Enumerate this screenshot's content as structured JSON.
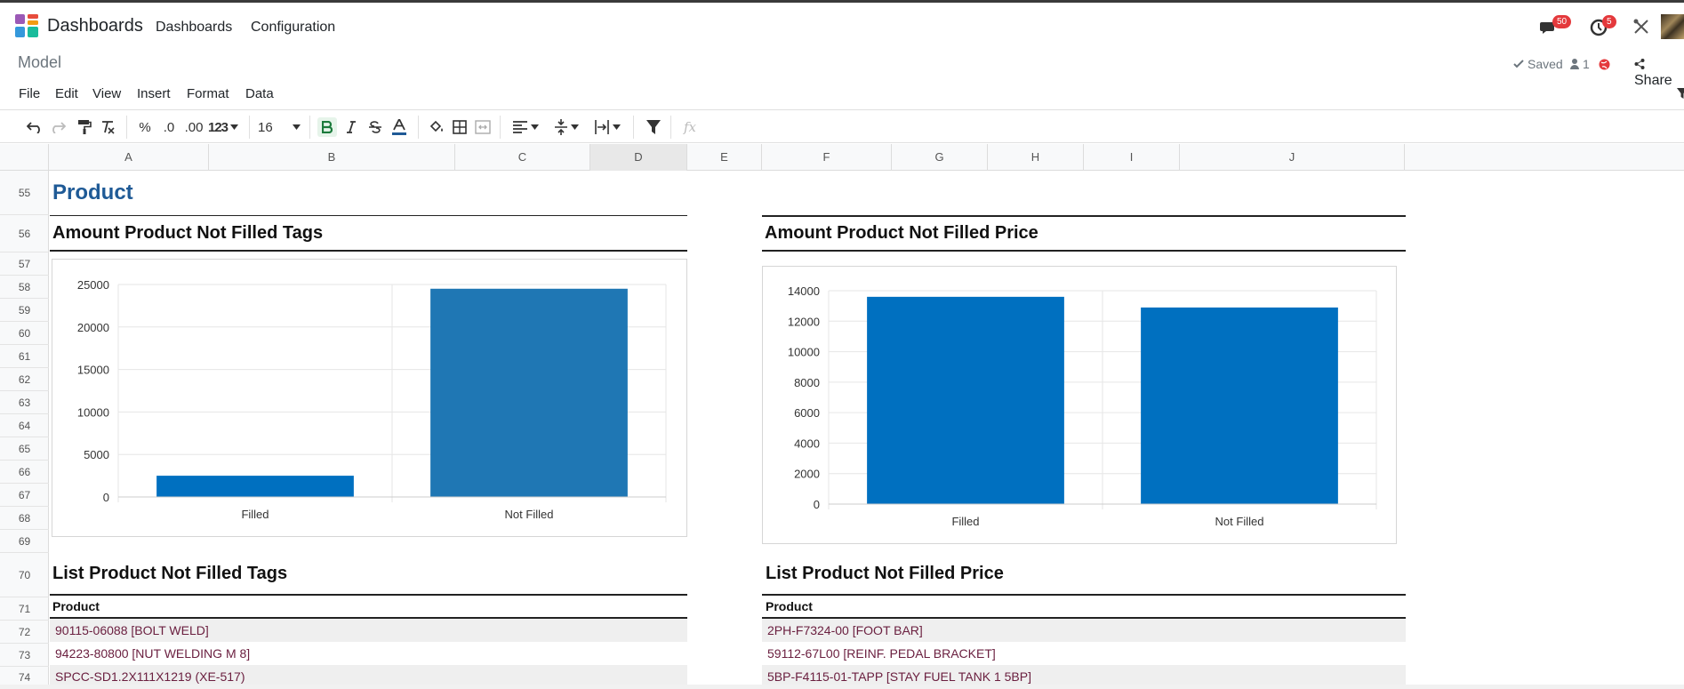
{
  "nav": {
    "app_name": "Dashboards",
    "menus": [
      "Dashboards",
      "Configuration"
    ],
    "messages_count": "50",
    "activities_count": "5"
  },
  "control": {
    "breadcrumb": "Model",
    "saved_label": "Saved",
    "users_count": "1",
    "share_label": "Share"
  },
  "menubar": [
    "File",
    "Edit",
    "View",
    "Insert",
    "Format",
    "Data"
  ],
  "toolbar": {
    "percent": "%",
    "dec_decrease": ".0",
    "dec_increase": ".00",
    "num_format": "123",
    "font_size": "16",
    "fx": "fx"
  },
  "columns": [
    "A",
    "B",
    "C",
    "D",
    "E",
    "F",
    "G",
    "H",
    "I",
    "J"
  ],
  "selected_column": "D",
  "rows": [
    "55",
    "56",
    "57",
    "58",
    "59",
    "60",
    "61",
    "62",
    "63",
    "64",
    "65",
    "66",
    "67",
    "68",
    "69",
    "70",
    "71",
    "72",
    "73",
    "74"
  ],
  "sheet": {
    "main_title": "Product",
    "left_chart_title": "Amount Product Not Filled Tags",
    "right_chart_title": "Amount Product Not Filled Price",
    "left_list_title": "List Product Not Filled Tags",
    "right_list_title": "List Product Not Filled Price",
    "left_list_header": "Product",
    "right_list_header": "Product",
    "left_list": [
      "90115-06088 [BOLT WELD]",
      "94223-80800 [NUT WELDING M 8]",
      "SPCC-SD1.2X111X1219 (XE-517)"
    ],
    "right_list": [
      "2PH-F7324-00 [FOOT BAR]",
      "59112-67L00 [REINF. PEDAL BRACKET]",
      "5BP-F4115-01-TAPP [STAY FUEL TANK 1 5BP]"
    ]
  },
  "colors": {
    "title_blue": "#1f5a96",
    "bar_dark": "#0070c0",
    "bar_mid": "#1f77b4",
    "list_text": "#6b2040",
    "badge_red": "#e4393c"
  },
  "chart_data": [
    {
      "type": "bar",
      "title": "",
      "categories": [
        "Filled",
        "Not Filled"
      ],
      "values": [
        2500,
        24500
      ],
      "colors": [
        "#0070c0",
        "#1f77b4"
      ],
      "yticks": [
        0,
        5000,
        10000,
        15000,
        20000,
        25000
      ],
      "ylim": [
        0,
        25000
      ],
      "grid": true
    },
    {
      "type": "bar",
      "title": "",
      "categories": [
        "Filled",
        "Not Filled"
      ],
      "values": [
        13600,
        12900
      ],
      "colors": [
        "#0070c0",
        "#0070c0"
      ],
      "yticks": [
        0,
        2000,
        4000,
        6000,
        8000,
        10000,
        12000,
        14000
      ],
      "ylim": [
        0,
        14000
      ],
      "grid": true
    }
  ]
}
